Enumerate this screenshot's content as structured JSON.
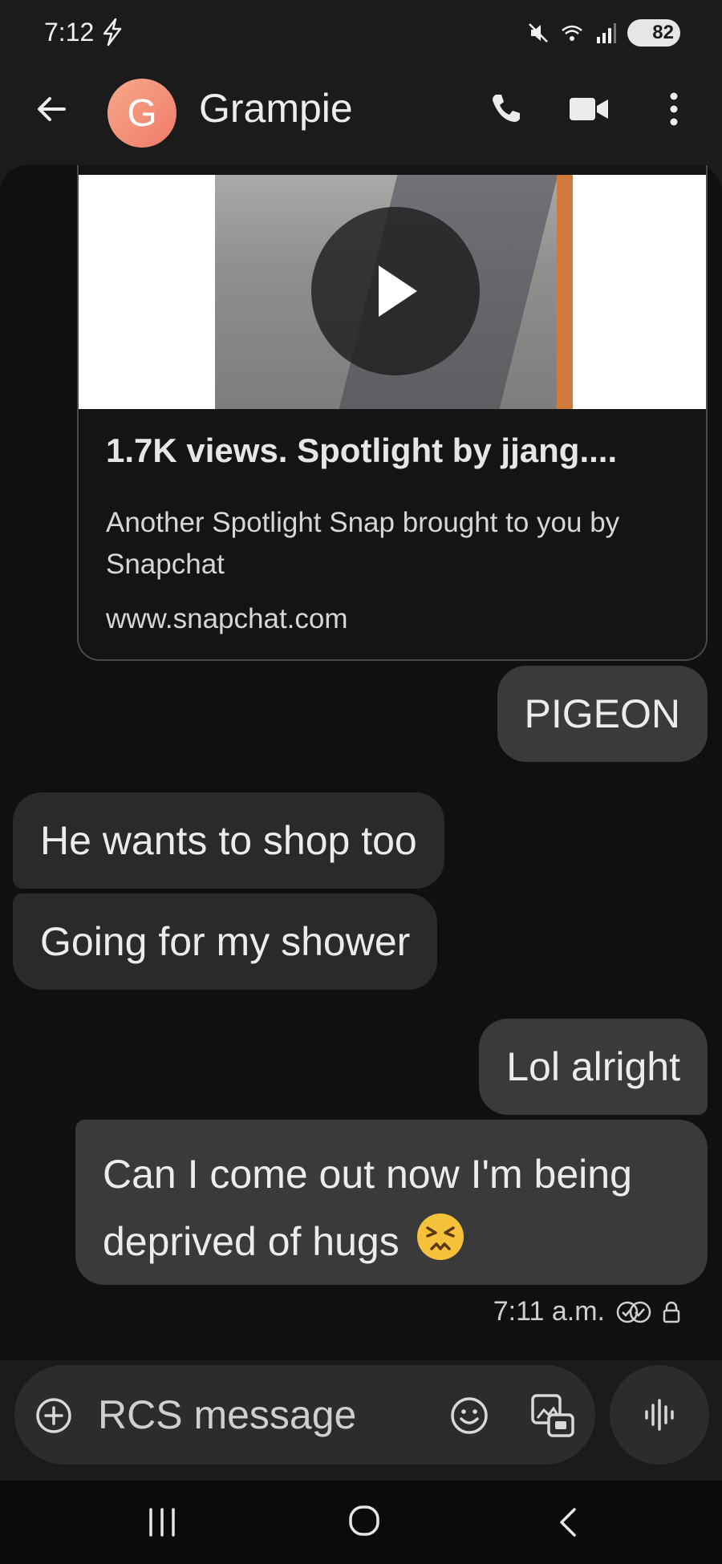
{
  "status_bar": {
    "time": "7:12",
    "battery": "82",
    "icons": [
      "bolt-icon",
      "mute-icon",
      "wifi-6e-icon",
      "signal-icon",
      "battery-icon"
    ]
  },
  "header": {
    "avatar_initial": "G",
    "contact_name": "Grampie",
    "icons": [
      "back-arrow-icon",
      "phone-icon",
      "video-camera-icon",
      "more-vert-icon"
    ]
  },
  "link_card": {
    "title": "1.7K views.  Spotlight by jjang....",
    "description": "Another Spotlight Snap brought to you by Snapchat",
    "url": "www.snapchat.com"
  },
  "messages": {
    "out_1": "PIGEON",
    "in_1": "He wants to shop too",
    "in_2": "Going for my shower",
    "out_2": "Lol alright",
    "out_3": "Can I come out now I'm being deprived of hugs",
    "out_3_emoji": "persevering-face-emoji"
  },
  "meta": {
    "timestamp": "7:11 a.m."
  },
  "composer": {
    "placeholder": "RCS message"
  },
  "colors": {
    "background": "#101010",
    "bubble": "#3a3a3a",
    "avatar": "#f39078"
  }
}
